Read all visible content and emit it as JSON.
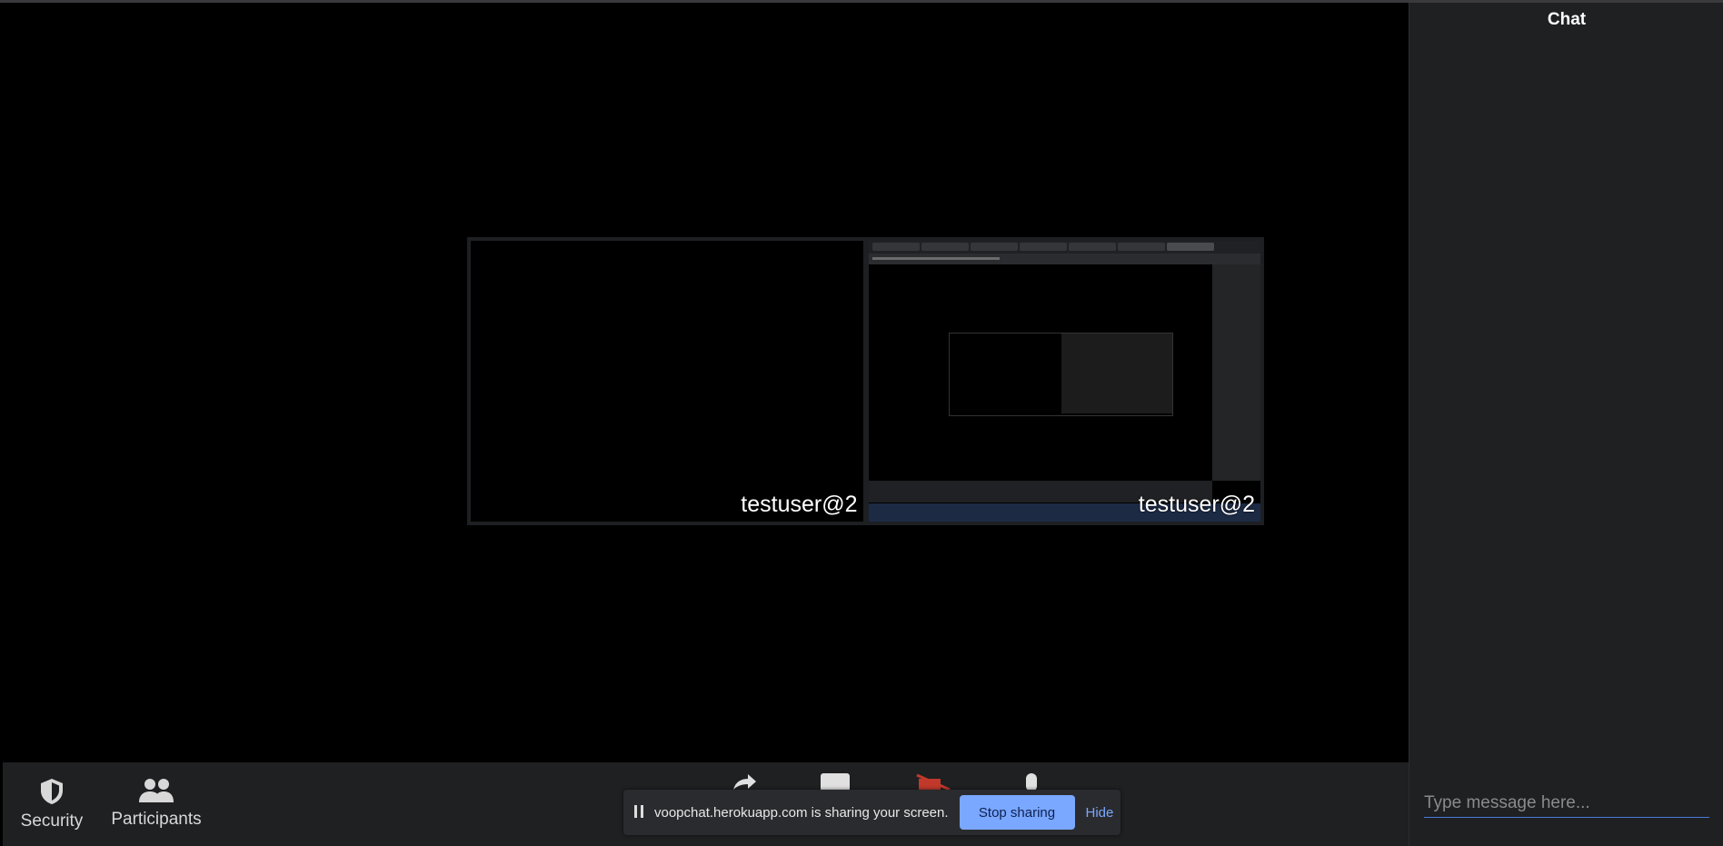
{
  "chat": {
    "title": "Chat",
    "input_placeholder": "Type message here..."
  },
  "video": {
    "tiles": [
      {
        "name": "testuser@2"
      },
      {
        "name": "testuser@2"
      }
    ]
  },
  "toolbar": {
    "security_label": "Security",
    "participants_label": "Participants"
  },
  "share_banner": {
    "text": "voopchat.herokuapp.com is sharing your screen.",
    "stop_label": "Stop sharing",
    "hide_label": "Hide"
  },
  "colors": {
    "accent": "#7aa7ff",
    "panel": "#1f2022",
    "stage": "#000000"
  }
}
